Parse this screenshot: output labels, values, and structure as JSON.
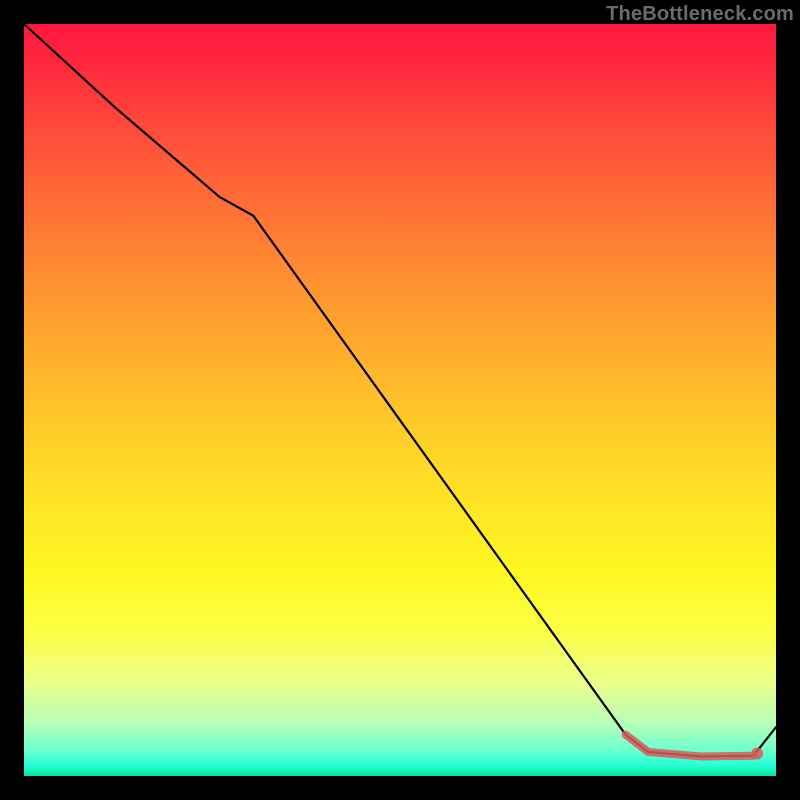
{
  "watermark": "TheBottleneck.com",
  "chart_data": {
    "type": "line",
    "title": "",
    "xlabel": "",
    "ylabel": "",
    "xlim": [
      0,
      100
    ],
    "ylim": [
      0,
      100
    ],
    "grid": false,
    "gradient_stops": [
      {
        "pos": 0,
        "color": "#ff163f"
      },
      {
        "pos": 0.5,
        "color": "#ffe326"
      },
      {
        "pos": 1.0,
        "color": "#00e59b"
      }
    ],
    "series": [
      {
        "name": "curve",
        "color": "#000000",
        "x": [
          0,
          12,
          26,
          30.5,
          80,
          83,
          90,
          97,
          100
        ],
        "y": [
          100,
          89,
          77,
          74.5,
          5.5,
          3.2,
          2.6,
          2.7,
          6.5
        ]
      }
    ],
    "highlight": {
      "name": "flat-bottom",
      "color": "#d85a5a",
      "x": [
        80,
        83,
        90,
        97
      ],
      "y": [
        5.5,
        3.2,
        2.6,
        2.7
      ],
      "end_dot": {
        "x": 97.5,
        "y": 3.0
      }
    }
  }
}
